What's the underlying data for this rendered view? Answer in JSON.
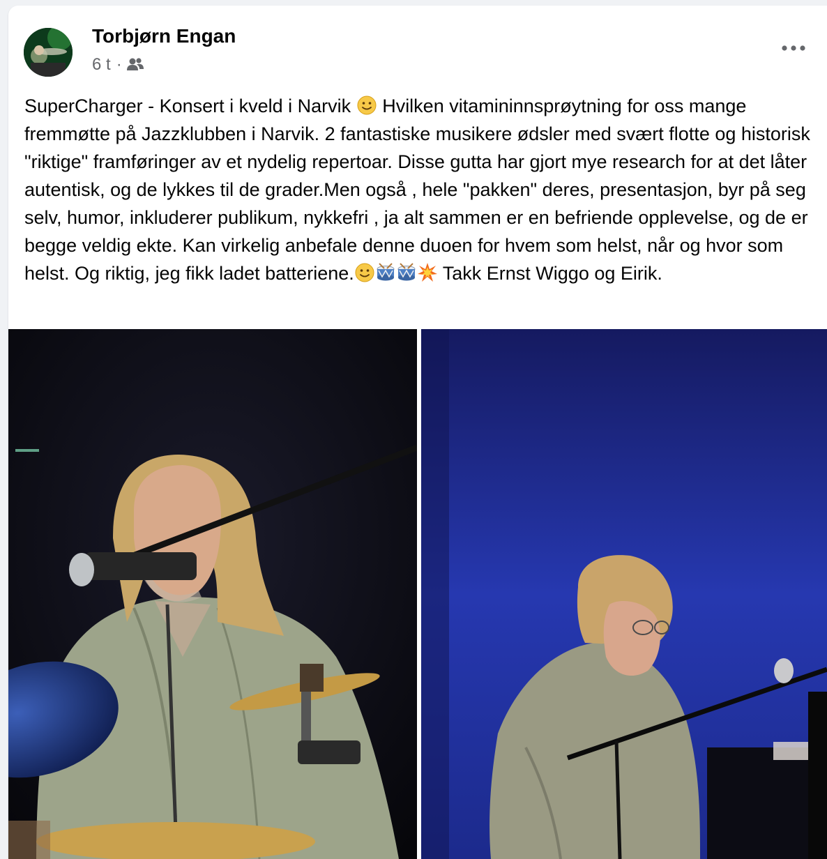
{
  "post": {
    "author": "Torbjørn Engan",
    "time": "6 t",
    "separator": "·",
    "audience_icon": "friends-icon",
    "more_icon": "more-horizontal-icon",
    "text_segments": [
      "SuperCharger - Konsert i kveld i Narvik ",
      " Hvilken vitamininnsprøytning for oss mange fremmøtte på Jazzklubben i Narvik. 2 fantastiske musikere ødsler med svært flotte og historisk \"riktige\" framføringer av et nydelig repertoar. Disse gutta har gjort mye research for at det låter autentisk, og de lykkes til de grader.Men også , hele \"pakken\" deres, presentasjon, byr på seg selv, humor, inkluderer publikum, nykkefri , ja alt sammen er en befriende opplevelse, og de er begge veldig ekte. Kan virkelig anbefale denne duoen for hvem som helst, når og hvor som helst. Og riktig, jeg fikk ladet batteriene.",
      " Takk Ernst Wiggo og Eirik."
    ],
    "emojis": [
      "slightly-smiling-face",
      "slightly-smiling-face",
      "drum",
      "drum",
      "collision"
    ]
  },
  "photos": [
    {
      "subject": "drummer-photo"
    },
    {
      "subject": "pianist-photo"
    }
  ],
  "colors": {
    "name": "#050505",
    "meta": "#65676b",
    "card": "#ffffff",
    "page": "#f0f2f5"
  }
}
